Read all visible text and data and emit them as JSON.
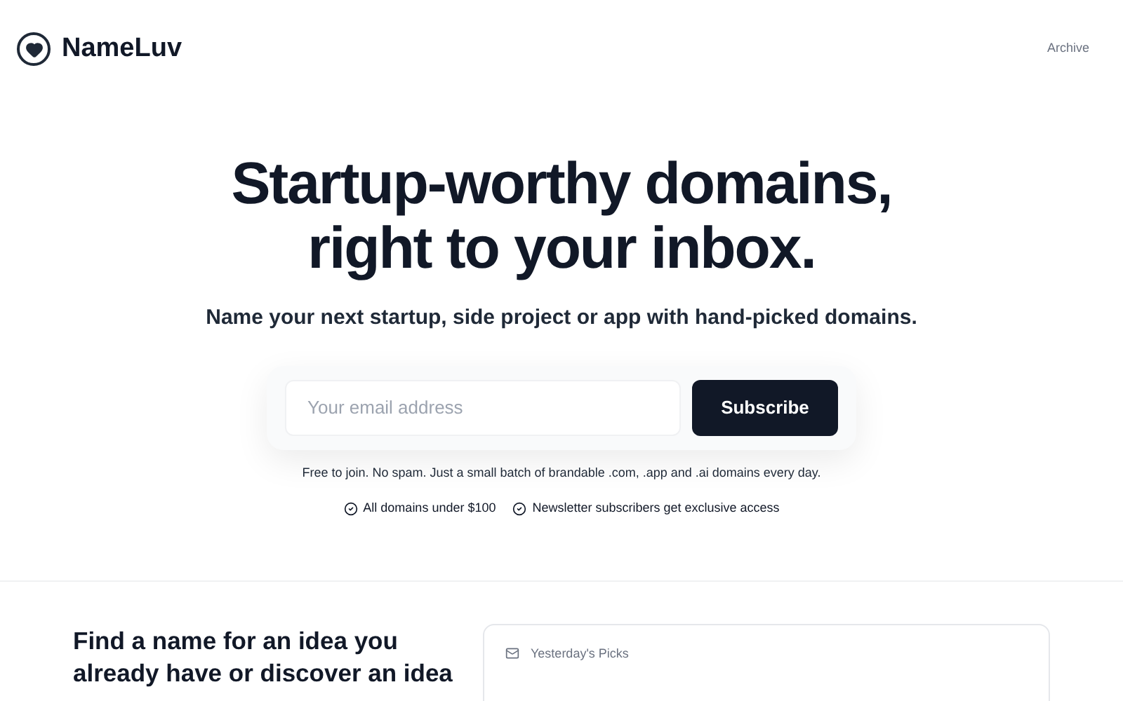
{
  "header": {
    "brand": "NameLuv",
    "nav": [
      "Archive"
    ]
  },
  "hero": {
    "title_lines": [
      "Startup-worthy domains,",
      "right to your inbox."
    ],
    "subtitle": "Name your next startup, side project or app with hand-picked domains.",
    "email": {
      "placeholder": "Your email address"
    },
    "button": "Subscribe",
    "note": "Free to join. No spam. Just a small batch of brandable .com, .app and .ai domains every day.",
    "perks": [
      "All domains under $100",
      "Newsletter subscribers get exclusive access"
    ]
  },
  "section": {
    "heading_lines": [
      "Find a name for an idea you",
      "already have or discover an idea"
    ],
    "card": {
      "title": "Yesterday's Picks"
    }
  }
}
